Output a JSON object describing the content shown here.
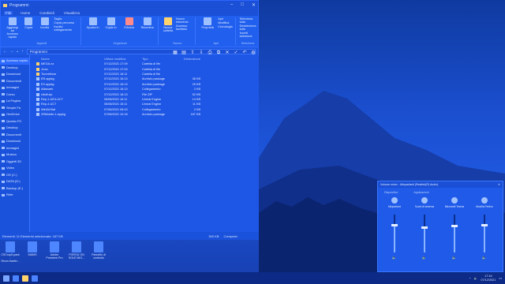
{
  "explorer": {
    "path_title": "Programmi",
    "menu_tabs": [
      "File",
      "Home",
      "Condividi",
      "Visualizza"
    ],
    "ribbon": {
      "clipboard": {
        "name": "Appunti",
        "items": [
          "Aggiungi ad Accesso rapido",
          "Copia",
          "Incolla"
        ],
        "small": [
          "Taglia",
          "Copia percorso",
          "Incolla collegamento"
        ]
      },
      "organize": {
        "name": "Organizza",
        "items": [
          "Sposta in",
          "Copia in",
          "Elimina",
          "Rinomina"
        ]
      },
      "new": {
        "name": "Nuovo",
        "items": [
          "Nuova cartella"
        ],
        "small": [
          "Nuovo elemento",
          "Accesso facilitato"
        ]
      },
      "open": {
        "name": "Apri",
        "items": [
          "Proprietà"
        ],
        "small": [
          "Apri",
          "Modifica",
          "Cronologia"
        ]
      },
      "select": {
        "name": "Seleziona",
        "small": [
          "Seleziona tutto",
          "Deseleziona tutto",
          "Inverti selezione"
        ]
      }
    },
    "address": "Programmi",
    "nav_items": [
      "Accesso rapido",
      "Desktop",
      "Download",
      "Documenti",
      "Immagini",
      "Corso",
      "La Pagina",
      "Simple Fa",
      "OneDrive",
      "Questo PC",
      "Desktop",
      "Documenti",
      "Download",
      "Immagini",
      "Musica",
      "Oggetti 3D",
      "Video",
      "OS (C:)",
      "DATA (D:)",
      "Backup (E:)",
      "Rete"
    ],
    "columns": {
      "name": "Nome",
      "date": "Ultima modifica",
      "type": "Tipo",
      "size": "Dimensione"
    },
    "files": [
      {
        "name": "MEGA.nz",
        "date": "07/12/2021 17:09",
        "type": "Cartella di file",
        "size": ""
      },
      {
        "name": "Jcmc",
        "date": "07/12/2021 17:03",
        "type": "Cartella di file",
        "size": ""
      },
      {
        "name": "Tunnelbear",
        "date": "07/12/2021 16:11",
        "type": "Cartella di file",
        "size": ""
      },
      {
        "name": "ER.appkg",
        "date": "07/12/2021 16:13",
        "type": "Archivio package",
        "size": "38 KB"
      },
      {
        "name": "EX.appkg",
        "date": "07/12/2021 16:13",
        "type": "Archivio package",
        "size": "25 KB"
      },
      {
        "name": "Atlasweb",
        "date": "07/12/2021 16:13",
        "type": "Collegamento",
        "size": "2 KB"
      },
      {
        "name": "clkdll.zip",
        "date": "07/12/2021 16:13",
        "type": "File ZIP",
        "size": "52 KB"
      },
      {
        "name": "Rep-1-UE4-UC7",
        "date": "05/08/2021 16:11",
        "type": "Unreal Engine",
        "size": "14 KB"
      },
      {
        "name": "Rep-4-UC7",
        "date": "05/08/2021 16:11",
        "type": "Unreal Engine",
        "size": "11 KB"
      },
      {
        "name": "WinDirStat",
        "date": "07/06/2021 08:43",
        "type": "Collegamento",
        "size": "2 KB"
      },
      {
        "name": "ZRMobile-1.appkg",
        "date": "07/06/2021 10:18",
        "type": "Archivio package",
        "size": "187 KB"
      }
    ],
    "status_left": "Elementi: 11  Elemento selezionato: 187 KB",
    "status_mid": "300 KB",
    "status_right": "Computer"
  },
  "desktop_icons": [
    "CSCrop5.pack - Strum.trasfer...",
    "WAMS",
    "Adobe Premiere Pro",
    "POROU ON SOLE MIO...",
    "Pannello di controllo"
  ],
  "mixer": {
    "title": "Volume mixer - Altoparlanti (Realtek(R) Audio)",
    "heading_device": "Dispositivo",
    "heading_apps": "Applicazioni",
    "channels": [
      {
        "name": "Altoparlanti",
        "level": 0.72
      },
      {
        "name": "Suoni di sistema",
        "level": 0.65
      },
      {
        "name": "Microsoft Teams",
        "level": 0.7
      },
      {
        "name": "Mozilla Firefox",
        "level": 0.72
      }
    ]
  },
  "taskbar": {
    "time": "17:16",
    "date": "07/12/2021"
  }
}
